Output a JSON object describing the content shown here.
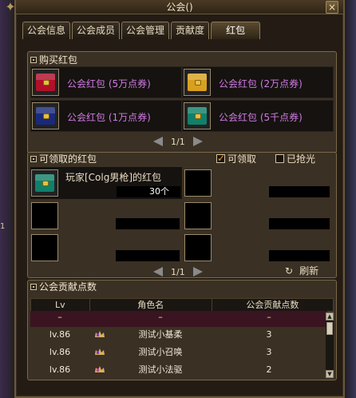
{
  "window": {
    "title": "公会()",
    "close_label": "×"
  },
  "side_text": "1",
  "tabs": [
    {
      "label": "公会信息"
    },
    {
      "label": "公会成员"
    },
    {
      "label": "公会管理"
    },
    {
      "label": "贡献度"
    },
    {
      "label": "红包"
    }
  ],
  "buy_section": {
    "title": "购买红包",
    "items": [
      {
        "label": "公会红包 (5万点券)",
        "color": "#b0102a"
      },
      {
        "label": "公会红包 (2万点券)",
        "color": "#d8a020"
      },
      {
        "label": "公会红包 (1万点券)",
        "color": "#1a2a7a"
      },
      {
        "label": "公会红包 (5千点券)",
        "color": "#10806a"
      }
    ],
    "page": "1/1"
  },
  "claim_section": {
    "title": "可领取的红包",
    "filter_claimable": "可领取",
    "filter_taken": "已抢光",
    "packets": [
      {
        "name": "玩家[Colg男枪]的红包",
        "amount": "30个",
        "color": "#10806a"
      }
    ],
    "page": "1/1",
    "refresh_label": "刷新"
  },
  "contrib_section": {
    "title": "公会贡献点数",
    "columns": [
      "Lv",
      "角色名",
      "公会贡献点数"
    ],
    "header_row": {
      "lv": "–",
      "name": "–",
      "points": "–"
    },
    "rows": [
      {
        "lv": "lv.86",
        "name": "测试小基柔",
        "points": "3"
      },
      {
        "lv": "lv.86",
        "name": "测试小召唤",
        "points": "3"
      },
      {
        "lv": "lv.86",
        "name": "测试小法驱",
        "points": "2"
      }
    ]
  },
  "colors": {
    "accent": "#d07ae0",
    "frame": "#7a6a48",
    "panel": "#3a3024"
  }
}
